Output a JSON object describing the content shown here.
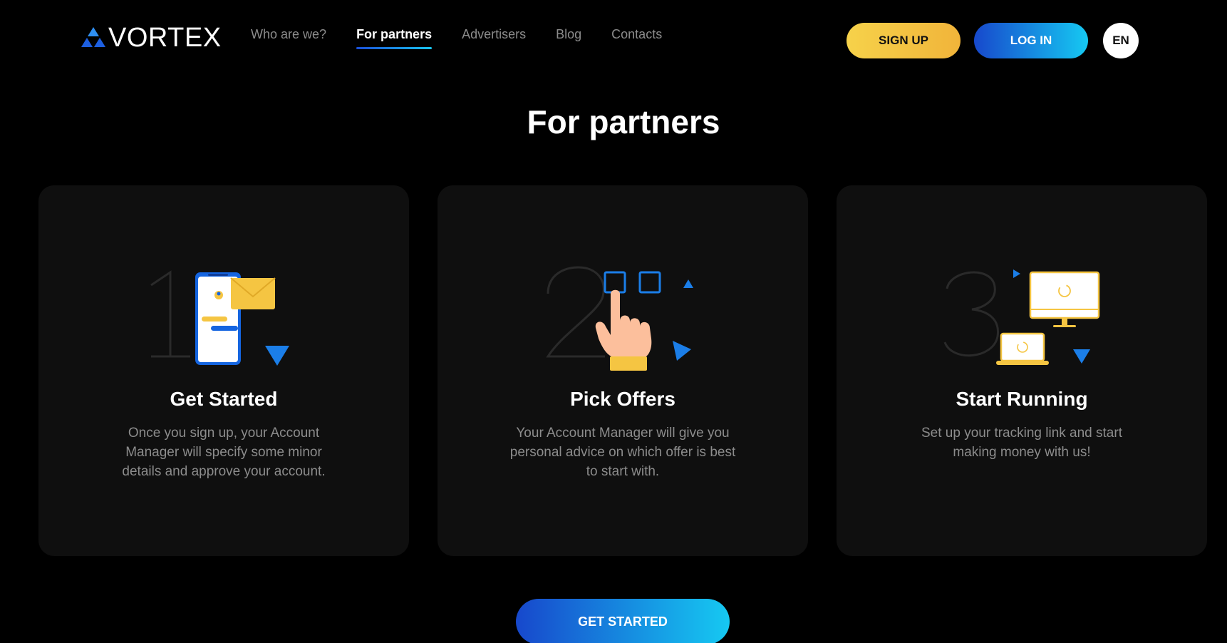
{
  "header": {
    "logo_text": "VORTEX",
    "nav": [
      {
        "label": "Who are we?",
        "active": false
      },
      {
        "label": "For partners",
        "active": true
      },
      {
        "label": "Advertisers",
        "active": false
      },
      {
        "label": "Blog",
        "active": false
      },
      {
        "label": "Contacts",
        "active": false
      }
    ],
    "signup_label": "SIGN UP",
    "login_label": "LOG IN",
    "lang_label": "EN"
  },
  "main": {
    "title": "For partners",
    "cards": [
      {
        "title": "Get Started",
        "text": "Once you sign up, your Account Manager will specify some minor details and approve your account."
      },
      {
        "title": "Pick Offers",
        "text": "Your Account Manager will give you personal advice on which offer is best to start with."
      },
      {
        "title": "Start Running",
        "text": "Set up your tracking link and start making money with us!"
      }
    ],
    "cta_label": "GET STARTED"
  },
  "colors": {
    "accent_blue_start": "#1748cc",
    "accent_blue_end": "#16c9f2",
    "accent_yellow": "#f6d24a",
    "card_bg": "#0f0f0f",
    "muted_text": "#8c8c8c"
  },
  "icons": [
    "vortex-logo-icon",
    "phone-chat-icon",
    "envelope-icon",
    "pointing-hand-icon",
    "monitor-icon",
    "laptop-icon",
    "triangle-icon"
  ]
}
